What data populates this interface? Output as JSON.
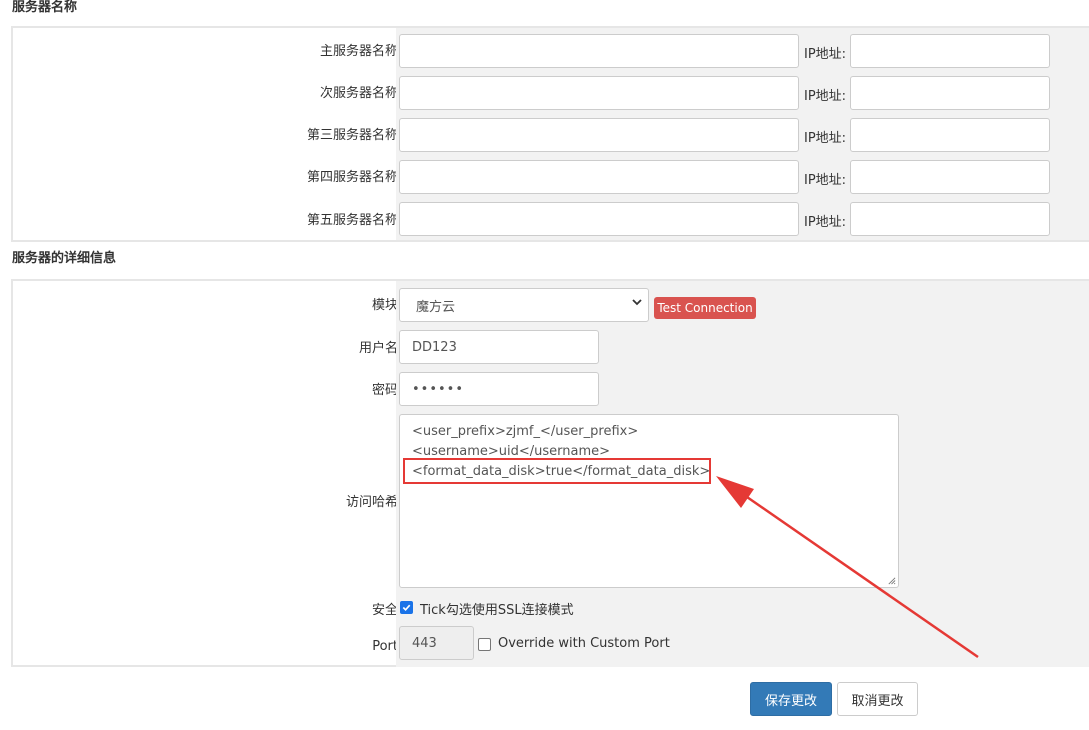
{
  "section1": {
    "title": "服务器名称",
    "ip_label": "IP地址:",
    "rows": [
      {
        "label": "主服务器名称",
        "name_value": "",
        "ip_value": ""
      },
      {
        "label": "次服务器名称",
        "name_value": "",
        "ip_value": ""
      },
      {
        "label": "第三服务器名称",
        "name_value": "",
        "ip_value": ""
      },
      {
        "label": "第四服务器名称",
        "name_value": "",
        "ip_value": ""
      },
      {
        "label": "第五服务器名称",
        "name_value": "",
        "ip_value": ""
      }
    ]
  },
  "section2": {
    "title": "服务器的详细信息",
    "module": {
      "label": "模块",
      "selected": "魔方云",
      "test_button": "Test Connection"
    },
    "username": {
      "label": "用户名",
      "value": "DD123"
    },
    "password": {
      "label": "密码",
      "value": "••••••"
    },
    "access_hash": {
      "label": "访问哈希",
      "lines": [
        "<user_prefix>zjmf_</user_prefix>",
        "<username>uid</username>",
        "<format_data_disk>true</format_data_disk>"
      ]
    },
    "security": {
      "label": "安全",
      "checkbox_label": "Tick勾选使用SSL连接模式",
      "checked": true
    },
    "port": {
      "label": "Port",
      "value": "443",
      "override_label": "Override with Custom Port",
      "override_checked": false
    }
  },
  "actions": {
    "save": "保存更改",
    "cancel": "取消更改"
  },
  "colors": {
    "primary": "#337ab7",
    "danger": "#d9534f",
    "annotation": "#e53935",
    "checkbox": "#1a73e8"
  }
}
